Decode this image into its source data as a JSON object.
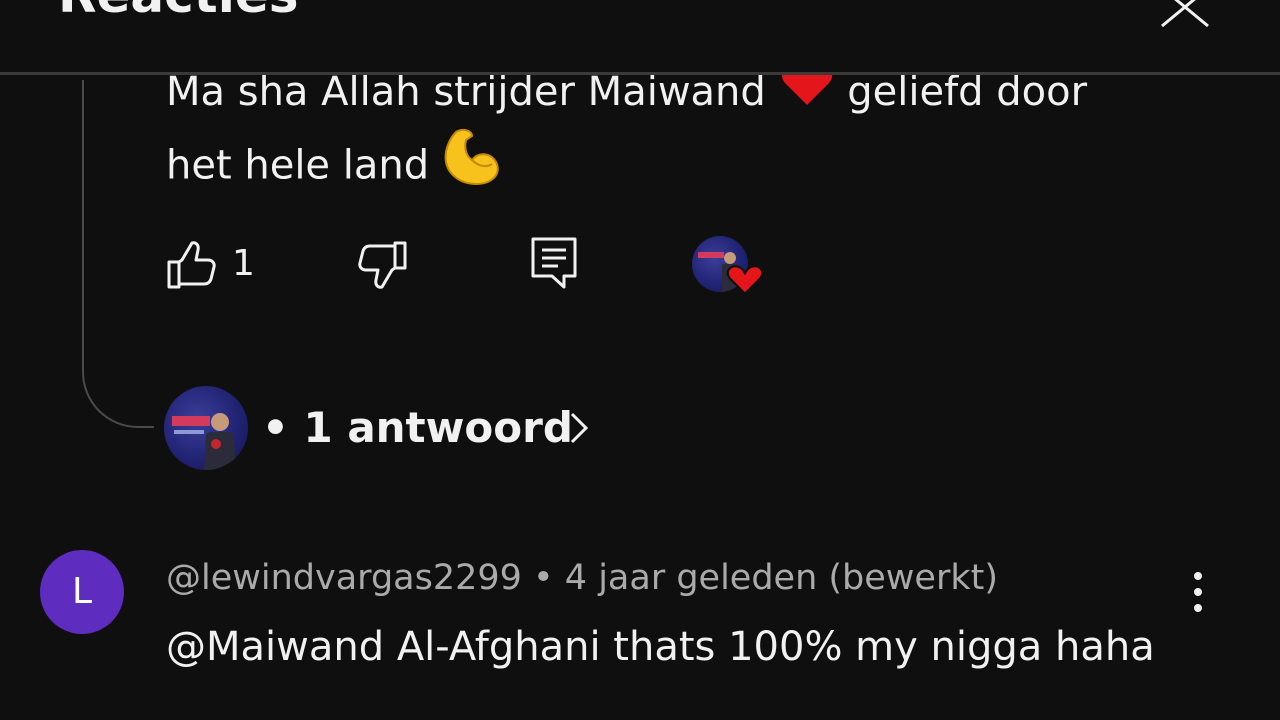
{
  "header": {
    "title": "Reacties",
    "close_icon": "close-icon"
  },
  "thread": {
    "comment_text": "Ma sha Allah strijder Maiwand",
    "comment_text_2": "geliefd door",
    "comment_text_3": "het hele land",
    "emojis": [
      "heart-emoji",
      "flexed-biceps-emoji"
    ],
    "actions": {
      "like_count": "1",
      "icons": [
        "thumbs-up-icon",
        "thumbs-down-icon",
        "reply-icon",
        "creator-heart-icon"
      ]
    },
    "replies_label": "• 1 antwoord"
  },
  "comment2": {
    "avatar_letter": "L",
    "meta": "@lewindvargas2299 • 4 jaar geleden (bewerkt)",
    "text": "@Maiwand Al-Afghani thats 100% my nigga haha"
  },
  "colors": {
    "background": "#0f0f0f",
    "text": "#f1f1f1",
    "meta": "#aaaaaa",
    "avatar_l": "#5e2dc0",
    "heart": "#e4161c"
  }
}
